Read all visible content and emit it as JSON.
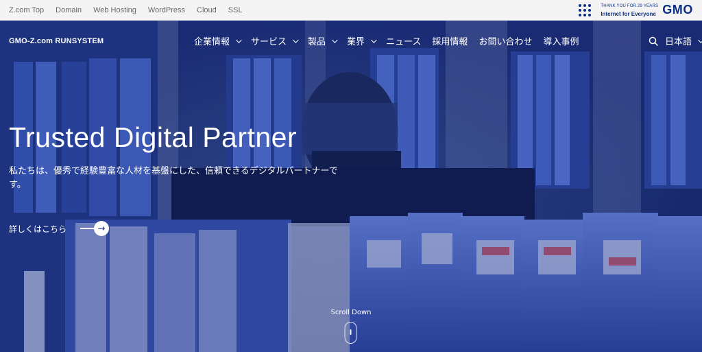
{
  "topbar": {
    "links": [
      "Z.com Top",
      "Domain",
      "Web Hosting",
      "WordPress",
      "Cloud",
      "SSL"
    ],
    "thanks_small": "THANK YOU FOR 29 YEARS",
    "thanks_big": "Internet for Everyone",
    "brand": "GMO"
  },
  "nav": {
    "brand": "GMO-Z.com RUNSYSTEM",
    "items": [
      {
        "label": "企業情報",
        "has_dropdown": true
      },
      {
        "label": "サービス",
        "has_dropdown": true
      },
      {
        "label": "製品",
        "has_dropdown": true
      },
      {
        "label": "業界",
        "has_dropdown": true
      },
      {
        "label": "ニュース",
        "has_dropdown": false
      },
      {
        "label": "採用情報",
        "has_dropdown": false
      },
      {
        "label": "お問い合わせ",
        "has_dropdown": false
      },
      {
        "label": "導入事例",
        "has_dropdown": false
      }
    ],
    "language": "日本語"
  },
  "hero": {
    "title": "Trusted Digital Partner",
    "subtitle": "私たちは、優秀で経験豊富な人材を基盤にした、信頼できるデジタルパートナーです。",
    "cta_label": "詳しくはこちら",
    "scroll_label": "Scroll Down"
  },
  "colors": {
    "hero_overlay": "#1d2f78",
    "gmo_brand": "#0b2f87",
    "topbar_bg": "#f4f4f4"
  }
}
